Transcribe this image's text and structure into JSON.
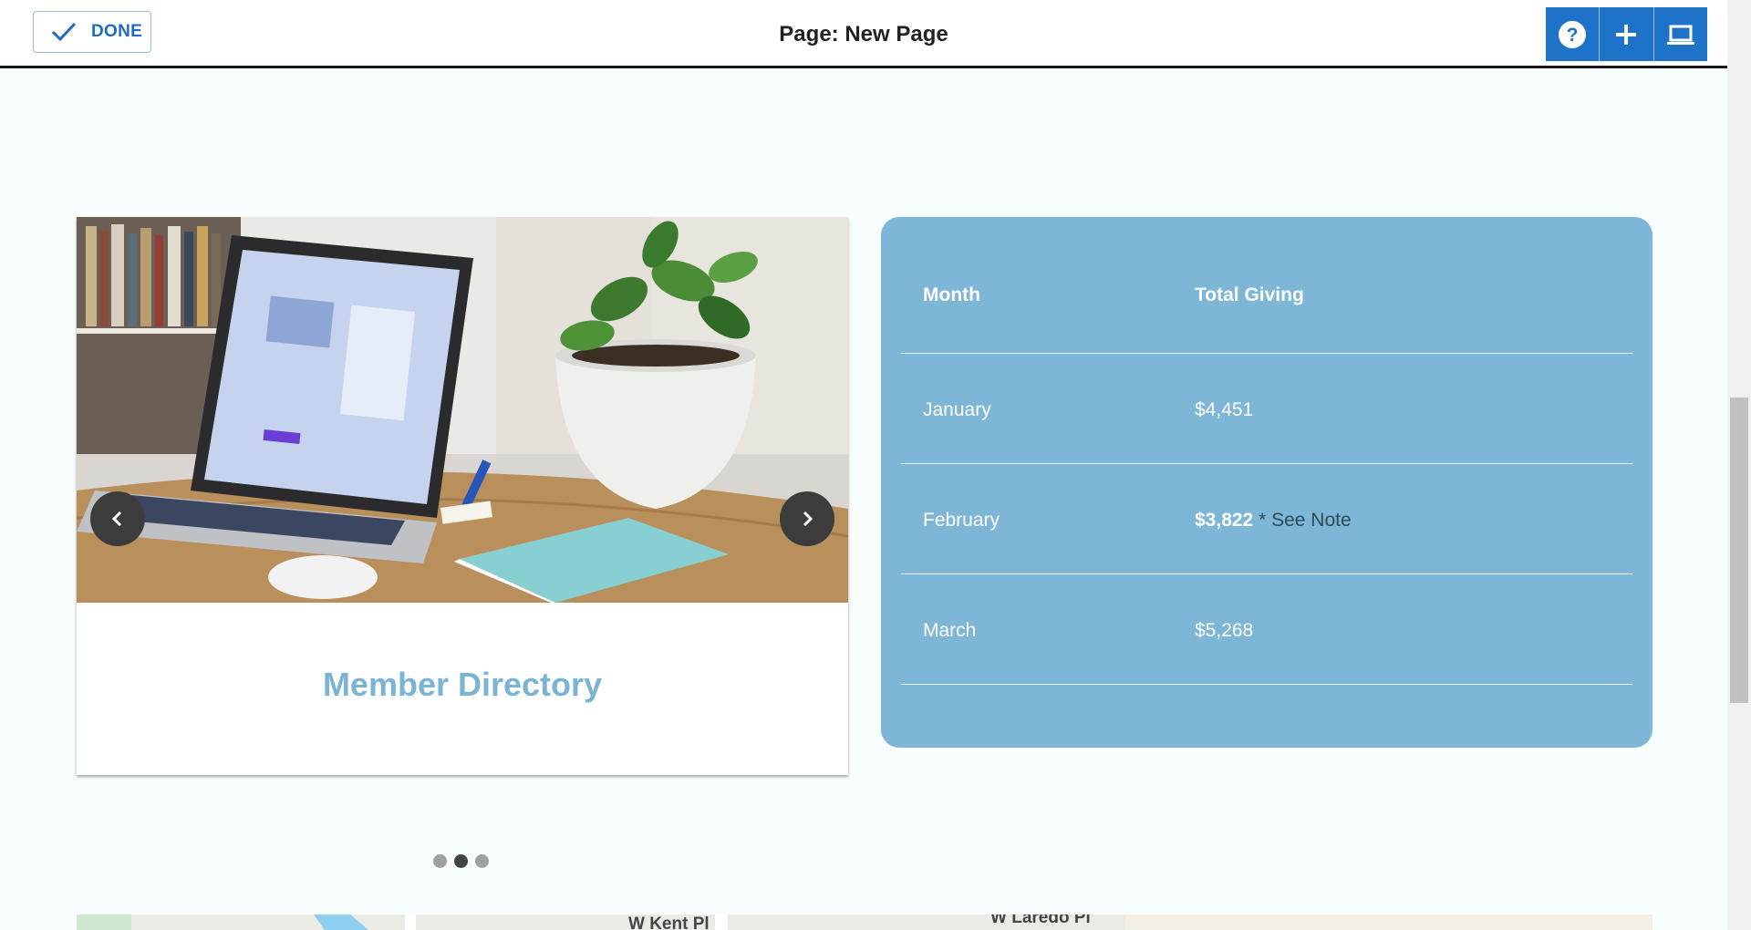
{
  "toolbar": {
    "done_label": "DONE",
    "page_title": "Page: New Page",
    "icons": [
      "help-icon",
      "plus-icon",
      "laptop-icon"
    ]
  },
  "carousel": {
    "title": "Member Directory",
    "image_subject": "laptop on a wooden desk beside a potted plant",
    "prev_icon": "chevron-left-icon",
    "next_icon": "chevron-right-icon",
    "slide_count": 3,
    "active_slide": 2
  },
  "giving_table": {
    "headers": [
      "Month",
      "Total Giving"
    ],
    "rows": [
      {
        "month": "January",
        "amount": "$4,451",
        "note": ""
      },
      {
        "month": "February",
        "amount": "$3,822",
        "note": " * See Note"
      },
      {
        "month": "March",
        "amount": "$5,268",
        "note": ""
      }
    ]
  },
  "map": {
    "labels": [
      "W Kent Pl",
      "W Laredo Pl"
    ]
  },
  "colors": {
    "accent": "#1e73c9",
    "panel": "#7db6d6",
    "title": "#7ab4d4"
  }
}
